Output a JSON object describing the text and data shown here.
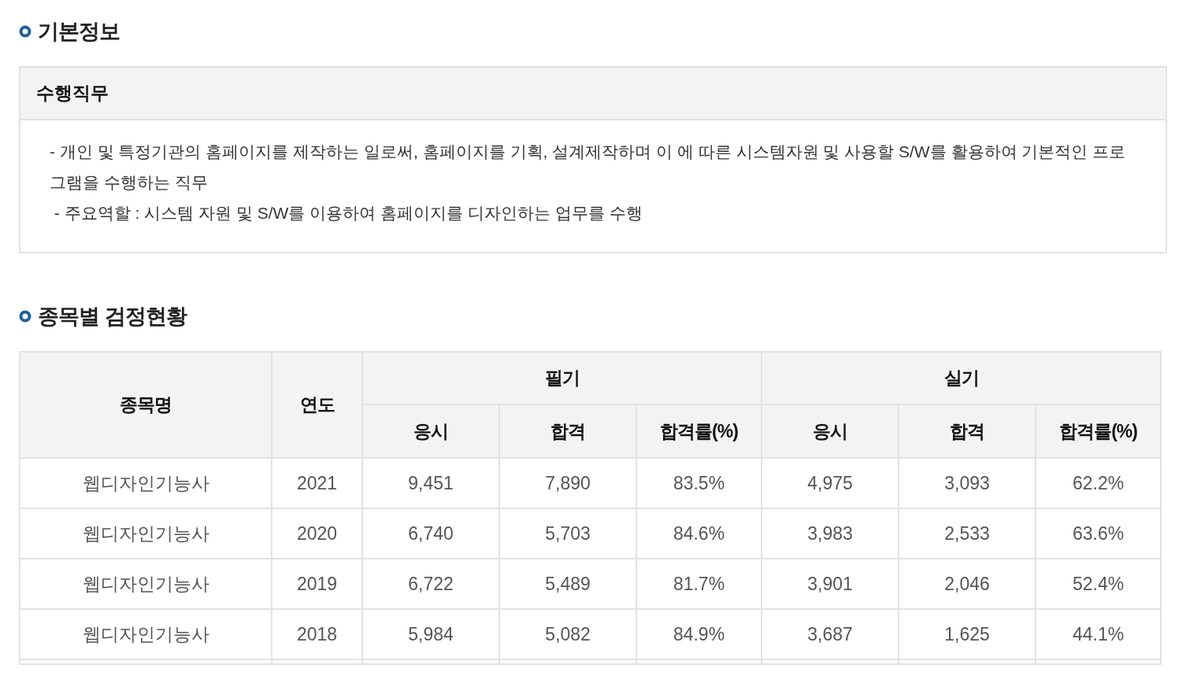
{
  "sections": [
    {
      "kind": "info",
      "title": "기본정보",
      "box": {
        "heading": "수행직무",
        "paragraphs": [
          "- 개인 및 특정기관의 홈페이지를 제작하는 일로써, 홈페이지를 기획, 설계제작하며 이 에 따른 시스템자원 및 사용할 S/W를 활용하여 기본적인 프로그램을 수행하는 직무",
          " - 주요역할 : 시스템 자원 및 S/W를 이용하여 홈페이지를 디자인하는 업무를 수행"
        ]
      }
    },
    {
      "kind": "table",
      "title": "종목별 검정현황",
      "table": {
        "name_header": "종목명",
        "year_header": "연도",
        "groups": [
          {
            "label": "필기",
            "columns": [
              "응시",
              "합격",
              "합격률(%)"
            ]
          },
          {
            "label": "실기",
            "columns": [
              "응시",
              "합격",
              "합격률(%)"
            ]
          }
        ],
        "rows": [
          [
            "웹디자인기능사",
            "2021",
            "9,451",
            "7,890",
            "83.5%",
            "4,975",
            "3,093",
            "62.2%"
          ],
          [
            "웹디자인기능사",
            "2020",
            "6,740",
            "5,703",
            "84.6%",
            "3,983",
            "2,533",
            "63.6%"
          ],
          [
            "웹디자인기능사",
            "2019",
            "6,722",
            "5,489",
            "81.7%",
            "3,901",
            "2,046",
            "52.4%"
          ],
          [
            "웹디자인기능사",
            "2018",
            "5,984",
            "5,082",
            "84.9%",
            "3,687",
            "1,625",
            "44.1%"
          ]
        ]
      }
    }
  ]
}
